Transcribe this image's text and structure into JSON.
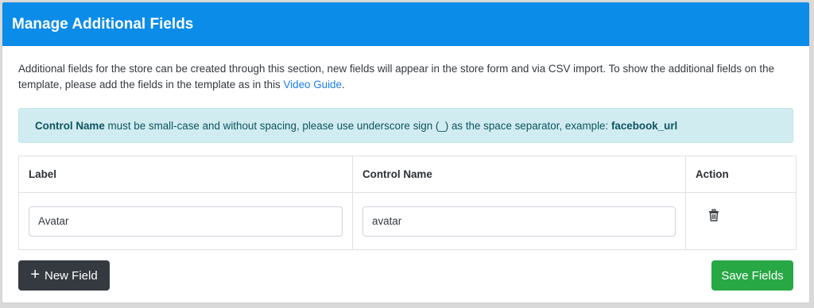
{
  "header": {
    "title": "Manage Additional Fields"
  },
  "description": {
    "text": "Additional fields for the store can be created through this section, new fields will appear in the store form and via CSV import. To show the additional fields on the template, please add the fields in the template as in this ",
    "link_text": "Video Guide",
    "end": "."
  },
  "alert": {
    "bold_start": "Control Name",
    "middle": " must be small-case and without spacing, please use underscore sign (_) as the space separator, example: ",
    "bold_end": "facebook_url"
  },
  "table": {
    "headers": {
      "label": "Label",
      "control_name": "Control Name",
      "action": "Action"
    },
    "rows": [
      {
        "label": "Avatar",
        "control_name": "avatar"
      }
    ]
  },
  "buttons": {
    "new_field_icon": "+",
    "new_field": "New Field",
    "save_fields": "Save Fields"
  },
  "colors": {
    "header_bg": "#0b8ce9",
    "alert_bg": "#d1ecf1",
    "new_button": "#343a40",
    "save_button": "#28a745",
    "link": "#1d7fe6"
  },
  "icons": {
    "delete": "trash-icon",
    "add": "plus-icon"
  }
}
